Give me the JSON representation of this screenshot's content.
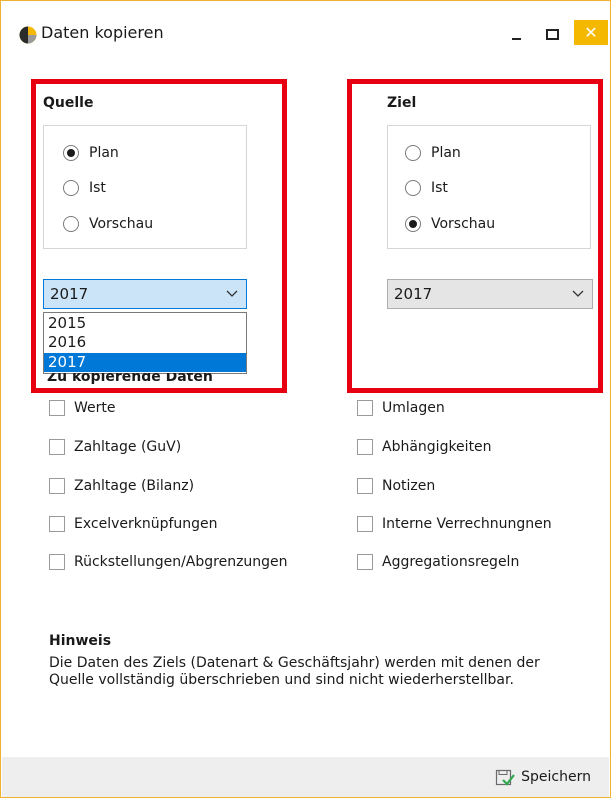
{
  "window": {
    "title": "Daten kopieren",
    "close_glyph": "✕"
  },
  "source": {
    "label": "Quelle",
    "options": [
      {
        "label": "Plan",
        "selected": true
      },
      {
        "label": "Ist",
        "selected": false
      },
      {
        "label": "Vorschau",
        "selected": false
      }
    ],
    "year": "2017",
    "dropdown_open": true,
    "year_options": [
      "2015",
      "2016",
      "2017"
    ],
    "highlighted_option": "2017"
  },
  "target": {
    "label": "Ziel",
    "options": [
      {
        "label": "Plan",
        "selected": false
      },
      {
        "label": "Ist",
        "selected": false
      },
      {
        "label": "Vorschau",
        "selected": true
      }
    ],
    "year": "2017"
  },
  "copy_section": {
    "caption": "Zu kopierende Daten",
    "left": [
      {
        "label": "Werte",
        "checked": false
      },
      {
        "label": "Zahltage (GuV)",
        "checked": false
      },
      {
        "label": "Zahltage (Bilanz)",
        "checked": false
      },
      {
        "label": "Excelverknüpfungen",
        "checked": false
      },
      {
        "label": "Rückstellungen/Abgrenzungen",
        "checked": false
      }
    ],
    "right": [
      {
        "label": "Umlagen",
        "checked": false
      },
      {
        "label": "Abhängigkeiten",
        "checked": false
      },
      {
        "label": "Notizen",
        "checked": false
      },
      {
        "label": "Interne Verrechnungnen",
        "checked": false
      },
      {
        "label": "Aggregationsregeln",
        "checked": false
      }
    ]
  },
  "hint": {
    "title": "Hinweis",
    "text": "Die Daten des Ziels (Datenart & Geschäftsjahr) werden mit denen der Quelle vollständig überschrieben und sind nicht wiederherstellbar."
  },
  "footer": {
    "save_label": "Speichern"
  },
  "colors": {
    "highlight": "#e60012",
    "accent": "#0078d7",
    "close": "#f5b800"
  }
}
